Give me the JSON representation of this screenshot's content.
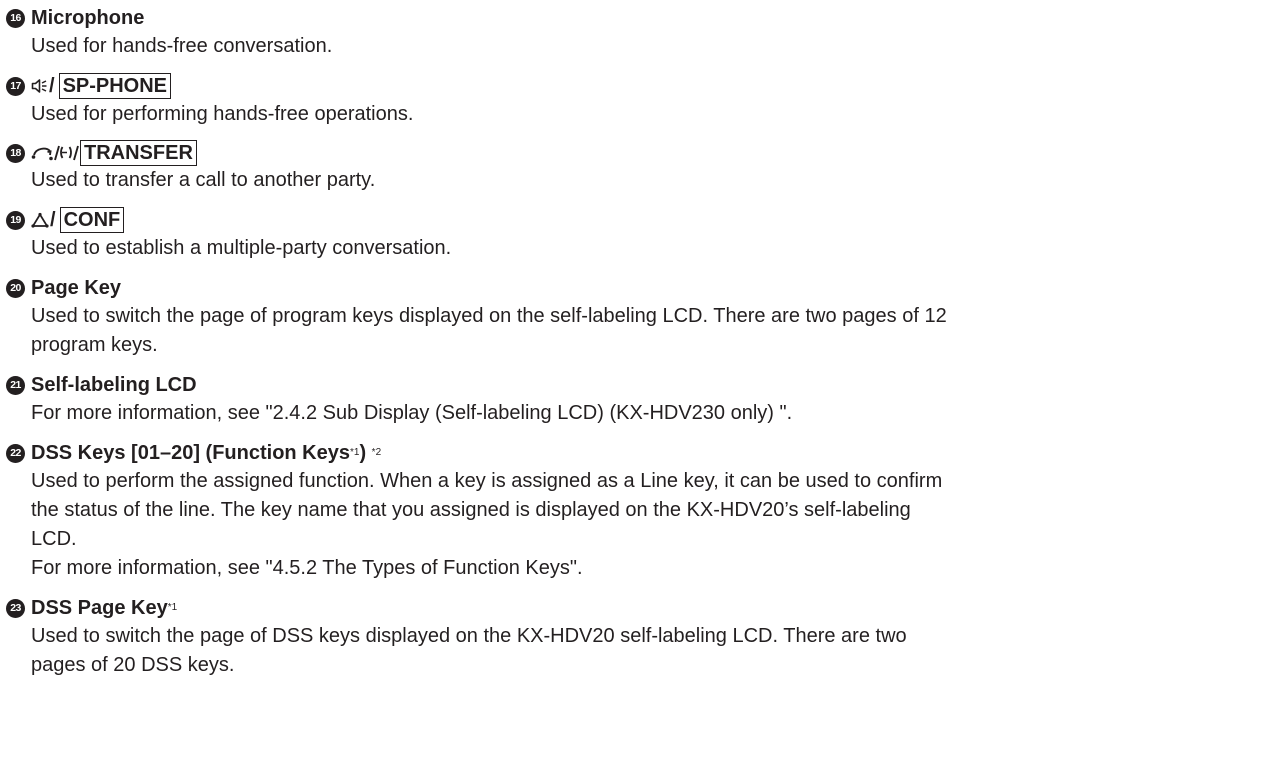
{
  "entries": [
    {
      "number": "16",
      "title": "Microphone",
      "lines": [
        "Used for hands-free conversation."
      ]
    },
    {
      "number": "17",
      "icon": "speaker-icon",
      "slash": "/",
      "key": "SP-PHONE",
      "lines": [
        "Used for performing hands-free operations."
      ]
    },
    {
      "number": "18",
      "icon": "transfer-icon",
      "slash": "/",
      "key": "TRANSFER",
      "lines": [
        "Used to transfer a call to another party."
      ]
    },
    {
      "number": "19",
      "icon": "conference-icon",
      "slash": "/",
      "key": "CONF",
      "lines": [
        "Used to establish a multiple-party conversation."
      ]
    },
    {
      "number": "20",
      "title": "Page Key",
      "lines": [
        "Used to switch the page of program keys displayed on the self-labeling LCD. There are two pages of 12",
        "program keys."
      ]
    },
    {
      "number": "21",
      "title": "Self-labeling LCD",
      "lines": [
        "For more information, see \"2.4.2  Sub Display (Self-labeling LCD) (KX-HDV230 only) \"."
      ]
    },
    {
      "number": "22",
      "title_a": "DSS Keys [01–20] (Function Keys",
      "sup_a": "*1",
      "title_b": ") ",
      "sup_b": "*2",
      "lines": [
        "Used to perform the assigned function. When a key is assigned as a Line key, it can be used to confirm",
        "the status of the line. The key name that you assigned is displayed on the KX-HDV20’s self-labeling",
        "LCD.",
        "For more information, see \"4.5.2 The Types of Function Keys\"."
      ]
    },
    {
      "number": "23",
      "title": "DSS Page Key",
      "sup": "*1",
      "lines": [
        "Used to switch the page of DSS keys displayed on the KX-HDV20 self-labeling LCD. There are two",
        "pages of 20 DSS keys."
      ]
    }
  ]
}
